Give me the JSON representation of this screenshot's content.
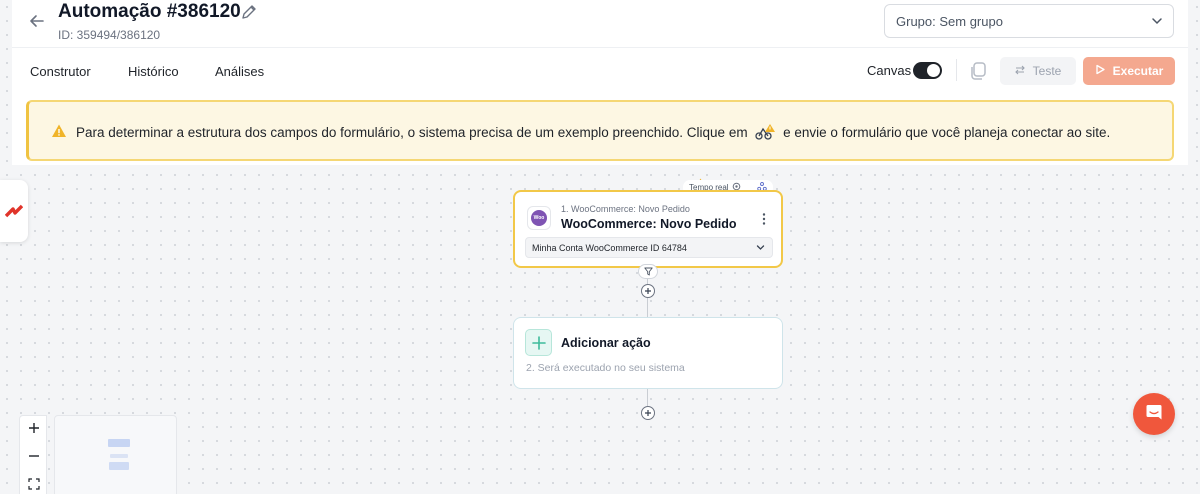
{
  "header": {
    "title": "Automação #386120",
    "subtitle": "ID: 359494/386120",
    "group_select": "Grupo: Sem grupo"
  },
  "tabs": [
    {
      "label": "Construtor"
    },
    {
      "label": "Histórico"
    },
    {
      "label": "Análises"
    }
  ],
  "toolbar": {
    "canvas_label": "Canvas",
    "canvas_on": true,
    "test_label": "Teste",
    "run_label": "Executar"
  },
  "warning": {
    "text_before": "Para determinar a estrutura dos campos do formulário, o sistema precisa de um exemplo preenchido. Clique em",
    "text_after": "e envie o formulário que você planeja conectar ao site."
  },
  "trigger": {
    "badge": "Tempo real",
    "step": "1. WooCommerce: Novo Pedido",
    "title": "WooCommerce: Novo Pedido",
    "logo_text": "Woo",
    "account": "Minha Conta WooCommerce ID 64784"
  },
  "action": {
    "title": "Adicionar ação",
    "description": "2. Será executado no seu sistema"
  },
  "colors": {
    "accent": "#f0573c",
    "run_button": "#f4a88f",
    "warning_border": "#f5d774",
    "warning_bg": "#fdf7e3",
    "woo_purple": "#7f54b3"
  }
}
